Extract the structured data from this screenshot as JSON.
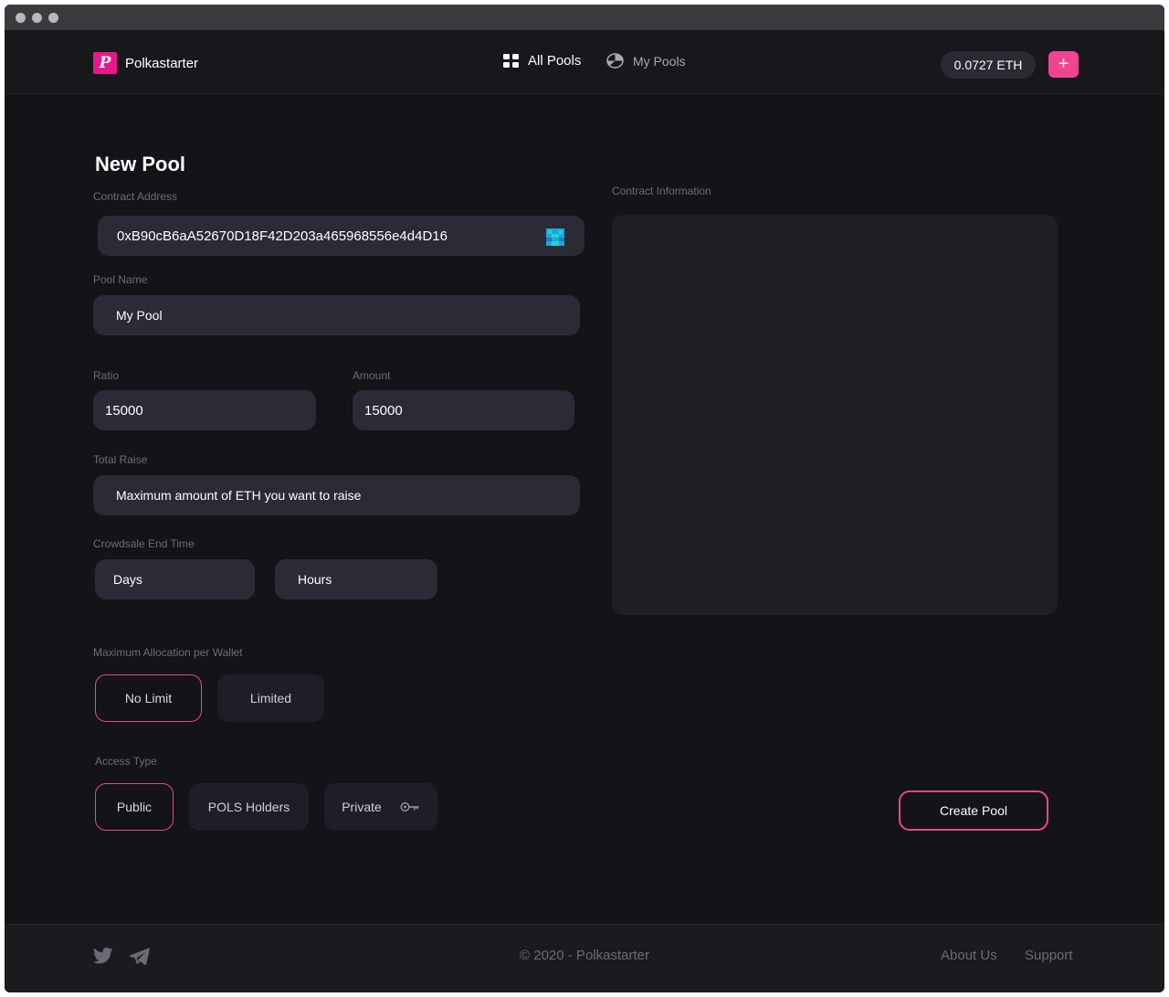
{
  "brand": {
    "name": "Polkastarter",
    "logo_letter": "P"
  },
  "nav": {
    "items": [
      {
        "label": "All Pools",
        "icon": "grid-icon",
        "active": true
      },
      {
        "label": "My Pools",
        "icon": "pie-chart-icon",
        "active": false
      }
    ],
    "balance": "0.0727 ETH",
    "add_label": "+"
  },
  "page": {
    "title": "New Pool"
  },
  "form": {
    "contract_address": {
      "label": "Contract Address",
      "value": "0xB90cB6aA52670D18F42D203a465968556e4d4D16"
    },
    "pool_name": {
      "label": "Pool Name",
      "value": "My Pool"
    },
    "ratio": {
      "label": "Ratio",
      "value": "15000"
    },
    "amount": {
      "label": "Amount",
      "value": "15000"
    },
    "total_raise": {
      "label": "Total Raise",
      "placeholder": "Maximum amount of ETH you want to raise"
    },
    "end_time": {
      "label": "Crowdsale End Time",
      "days": "Days",
      "hours": "Hours"
    },
    "max_allocation": {
      "label": "Maximum Allocation per Wallet",
      "options": [
        {
          "label": "No Limit",
          "selected": true
        },
        {
          "label": "Limited",
          "selected": false
        }
      ]
    },
    "access_type": {
      "label": "Access Type",
      "options": [
        {
          "label": "Public",
          "selected": true
        },
        {
          "label": "POLS Holders",
          "selected": false
        },
        {
          "label": "Private",
          "selected": false,
          "icon": "key-icon"
        }
      ]
    },
    "submit_label": "Create Pool"
  },
  "contract_info": {
    "label": "Contract Information"
  },
  "footer": {
    "copyright": "© 2020 - Polkastarter",
    "links": [
      "About Us",
      "Support"
    ],
    "social": [
      "twitter-icon",
      "telegram-icon"
    ]
  },
  "colors": {
    "accent": "#e8488b",
    "accent_fill": "#f0458e",
    "brand": "#e8188c",
    "background": "#131318",
    "field": "#2b2b35"
  }
}
